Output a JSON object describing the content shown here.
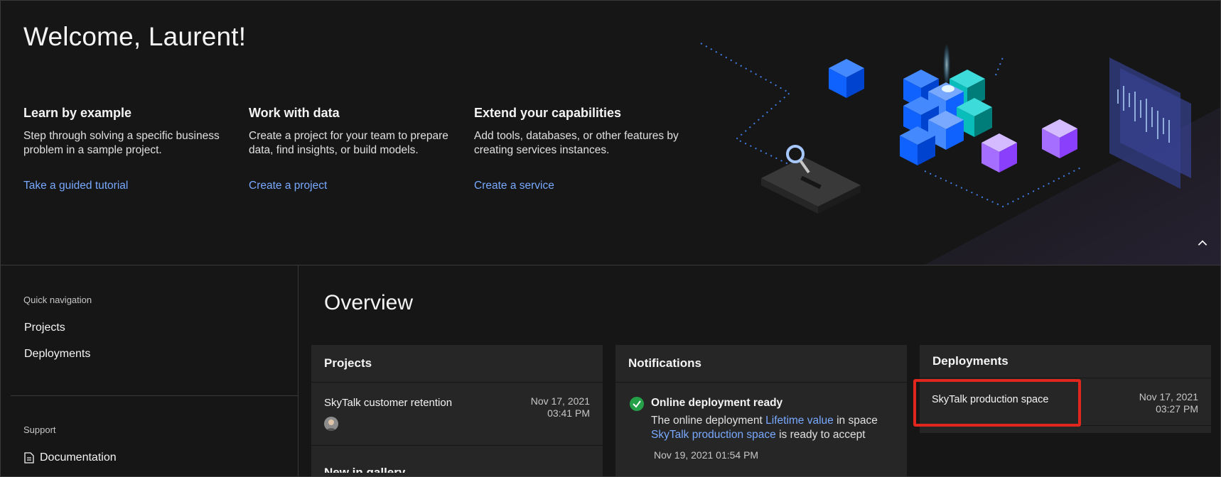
{
  "hero": {
    "welcome": "Welcome, Laurent!",
    "columns": [
      {
        "title": "Learn by example",
        "text": "Step through solving a specific business problem in a sample project.",
        "link": "Take a guided tutorial"
      },
      {
        "title": "Work with data",
        "text": "Create a project for your team to prepare data, find insights, or build models.",
        "link": "Create a project"
      },
      {
        "title": "Extend your capabilities",
        "text": "Add tools, databases, or other features by creating services instances.",
        "link": "Create a service"
      }
    ]
  },
  "sidebar": {
    "quick_nav_label": "Quick navigation",
    "nav_items": [
      "Projects",
      "Deployments"
    ],
    "support_label": "Support",
    "documentation": "Documentation"
  },
  "overview": {
    "title": "Overview",
    "projects": {
      "title": "Projects",
      "item_name": "SkyTalk customer retention",
      "date": "Nov 17, 2021",
      "time": "03:41 PM"
    },
    "notifications": {
      "title": "Notifications",
      "item_title": "Online deployment ready",
      "line1_prefix": "The online deployment ",
      "line1_link": "Lifetime value",
      "line1_suffix": " in space",
      "line2_link": "SkyTalk production space",
      "line2_suffix": " is ready to accept",
      "timestamp": "Nov 19, 2021 01:54 PM"
    },
    "gallery_peek": "New in gallery",
    "deployments": {
      "title": "Deployments",
      "item_name": "SkyTalk production space",
      "date": "Nov 17, 2021",
      "time": "03:27 PM"
    }
  },
  "colors": {
    "background": "#161616",
    "card": "#262626",
    "link": "#78a9ff",
    "success": "#24a148",
    "highlight": "#e0261d"
  }
}
